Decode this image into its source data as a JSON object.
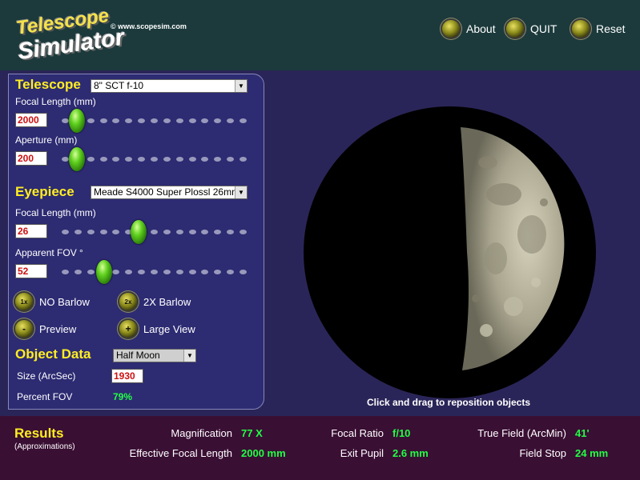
{
  "header": {
    "logo_line1": "Telescope",
    "logo_line2": "Simulator",
    "site": "© www.scopesim.com",
    "buttons": {
      "about": "About",
      "quit": "QUIT",
      "reset": "Reset"
    }
  },
  "telescope": {
    "title": "Telescope",
    "model": "8\" SCT f-10",
    "focal_length_label": "Focal Length (mm)",
    "focal_length_value": "2000",
    "focal_length_level": 0.04,
    "aperture_label": "Aperture (mm)",
    "aperture_value": "200",
    "aperture_level": 0.04
  },
  "eyepiece": {
    "title": "Eyepiece",
    "model": "Meade S4000 Super Plossl 26mm",
    "focal_length_label": "Focal Length (mm)",
    "focal_length_value": "26",
    "focal_length_level": 0.4,
    "apparent_fov_label": "Apparent FOV °",
    "apparent_fov_value": "52",
    "apparent_fov_level": 0.2
  },
  "options": {
    "no_barlow_icon": "1x",
    "no_barlow": "NO Barlow",
    "barlow_2x_icon": "2x",
    "barlow_2x": "2X Barlow",
    "preview_icon": "-",
    "preview": "Preview",
    "large_view_icon": "+",
    "large_view": "Large View"
  },
  "object": {
    "title": "Object Data",
    "selected": "Half Moon",
    "size_label": "Size (ArcSec)",
    "size_value": "1930",
    "percent_label": "Percent FOV",
    "percent_value": "79%"
  },
  "view": {
    "hint": "Click and drag to reposition objects"
  },
  "results": {
    "title": "Results",
    "subtitle": "(Approximations)",
    "magnification_label": "Magnification",
    "magnification_value": "77 X",
    "efl_label": "Effective Focal Length",
    "efl_value": "2000 mm",
    "focal_ratio_label": "Focal Ratio",
    "focal_ratio_value": "f/10",
    "exit_pupil_label": "Exit Pupil",
    "exit_pupil_value": "2.6 mm",
    "true_field_label": "True Field (ArcMin)",
    "true_field_value": "41'",
    "field_stop_label": "Field Stop",
    "field_stop_value": "24 mm"
  },
  "colors": {
    "header_bg": "#1c3a3c",
    "panel_bg": "#2d2b72",
    "results_bg": "#3a0f34",
    "title_yellow": "#ffee22",
    "value_green": "#22ff44",
    "input_red": "#cc1111"
  }
}
